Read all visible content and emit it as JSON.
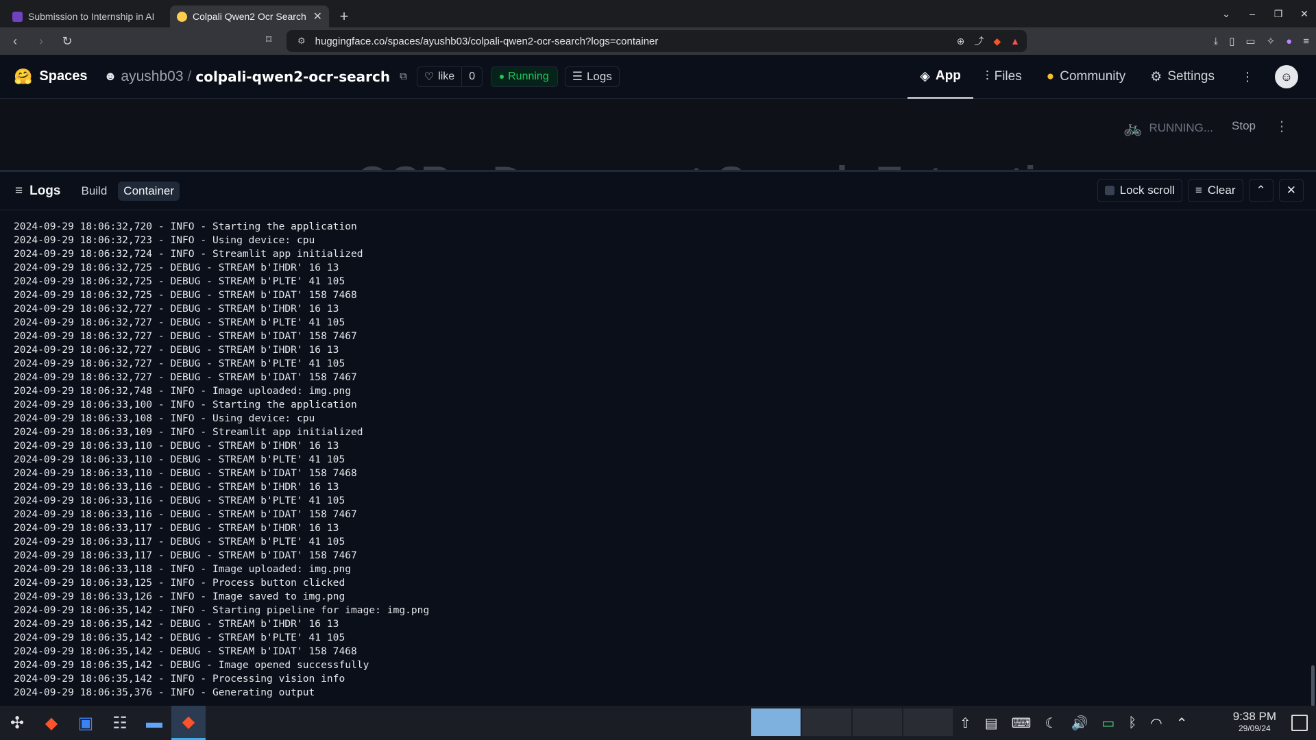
{
  "browser": {
    "tabs": [
      {
        "title": "Submission to Internship in AI",
        "favicon_color": "#6f42c1",
        "active": false
      },
      {
        "title": "Colpali Qwen2 Ocr Search",
        "favicon_color": "#ffcc4d",
        "active": true
      }
    ],
    "new_tab": "+",
    "url": "huggingface.co/spaces/ayushb03/colpali-qwen2-ocr-search?logs=container"
  },
  "hf": {
    "brand": "Spaces",
    "owner": "ayushb03",
    "slash": "/",
    "repo_name": "colpali-qwen2-ocr-search",
    "like_label": "like",
    "like_count": "0",
    "status": "Running",
    "logs_label": "Logs",
    "nav": {
      "app": "App",
      "files": "Files",
      "community": "Community",
      "settings": "Settings"
    }
  },
  "app": {
    "running_text": "RUNNING...",
    "stop_label": "Stop",
    "ghost_title": "OCR - Document Search Extractio"
  },
  "logs": {
    "title": "Logs",
    "tabs": [
      "Build",
      "Container"
    ],
    "active_tab": "Container",
    "lock_scroll": "Lock scroll",
    "clear": "Clear",
    "lines": [
      "2024-09-29 18:06:32,720 - INFO - Starting the application",
      "2024-09-29 18:06:32,723 - INFO - Using device: cpu",
      "2024-09-29 18:06:32,724 - INFO - Streamlit app initialized",
      "2024-09-29 18:06:32,725 - DEBUG - STREAM b'IHDR' 16 13",
      "2024-09-29 18:06:32,725 - DEBUG - STREAM b'PLTE' 41 105",
      "2024-09-29 18:06:32,725 - DEBUG - STREAM b'IDAT' 158 7468",
      "2024-09-29 18:06:32,727 - DEBUG - STREAM b'IHDR' 16 13",
      "2024-09-29 18:06:32,727 - DEBUG - STREAM b'PLTE' 41 105",
      "2024-09-29 18:06:32,727 - DEBUG - STREAM b'IDAT' 158 7467",
      "2024-09-29 18:06:32,727 - DEBUG - STREAM b'IHDR' 16 13",
      "2024-09-29 18:06:32,727 - DEBUG - STREAM b'PLTE' 41 105",
      "2024-09-29 18:06:32,727 - DEBUG - STREAM b'IDAT' 158 7467",
      "2024-09-29 18:06:32,748 - INFO - Image uploaded: img.png",
      "2024-09-29 18:06:33,100 - INFO - Starting the application",
      "2024-09-29 18:06:33,108 - INFO - Using device: cpu",
      "2024-09-29 18:06:33,109 - INFO - Streamlit app initialized",
      "2024-09-29 18:06:33,110 - DEBUG - STREAM b'IHDR' 16 13",
      "2024-09-29 18:06:33,110 - DEBUG - STREAM b'PLTE' 41 105",
      "2024-09-29 18:06:33,110 - DEBUG - STREAM b'IDAT' 158 7468",
      "2024-09-29 18:06:33,116 - DEBUG - STREAM b'IHDR' 16 13",
      "2024-09-29 18:06:33,116 - DEBUG - STREAM b'PLTE' 41 105",
      "2024-09-29 18:06:33,116 - DEBUG - STREAM b'IDAT' 158 7467",
      "2024-09-29 18:06:33,117 - DEBUG - STREAM b'IHDR' 16 13",
      "2024-09-29 18:06:33,117 - DEBUG - STREAM b'PLTE' 41 105",
      "2024-09-29 18:06:33,117 - DEBUG - STREAM b'IDAT' 158 7467",
      "2024-09-29 18:06:33,118 - INFO - Image uploaded: img.png",
      "2024-09-29 18:06:33,125 - INFO - Process button clicked",
      "2024-09-29 18:06:33,126 - INFO - Image saved to img.png",
      "2024-09-29 18:06:35,142 - INFO - Starting pipeline for image: img.png",
      "2024-09-29 18:06:35,142 - DEBUG - STREAM b'IHDR' 16 13",
      "2024-09-29 18:06:35,142 - DEBUG - STREAM b'PLTE' 41 105",
      "2024-09-29 18:06:35,142 - DEBUG - STREAM b'IDAT' 158 7468",
      "2024-09-29 18:06:35,142 - DEBUG - Image opened successfully",
      "2024-09-29 18:06:35,142 - INFO - Processing vision info",
      "2024-09-29 18:06:35,376 - INFO - Generating output"
    ]
  },
  "taskbar": {
    "time": "9:38 PM",
    "date": "29/09/24"
  },
  "colors": {
    "running_green": "#22c55e",
    "background": "#0b0f19",
    "brave_orange": "#fb542b"
  }
}
